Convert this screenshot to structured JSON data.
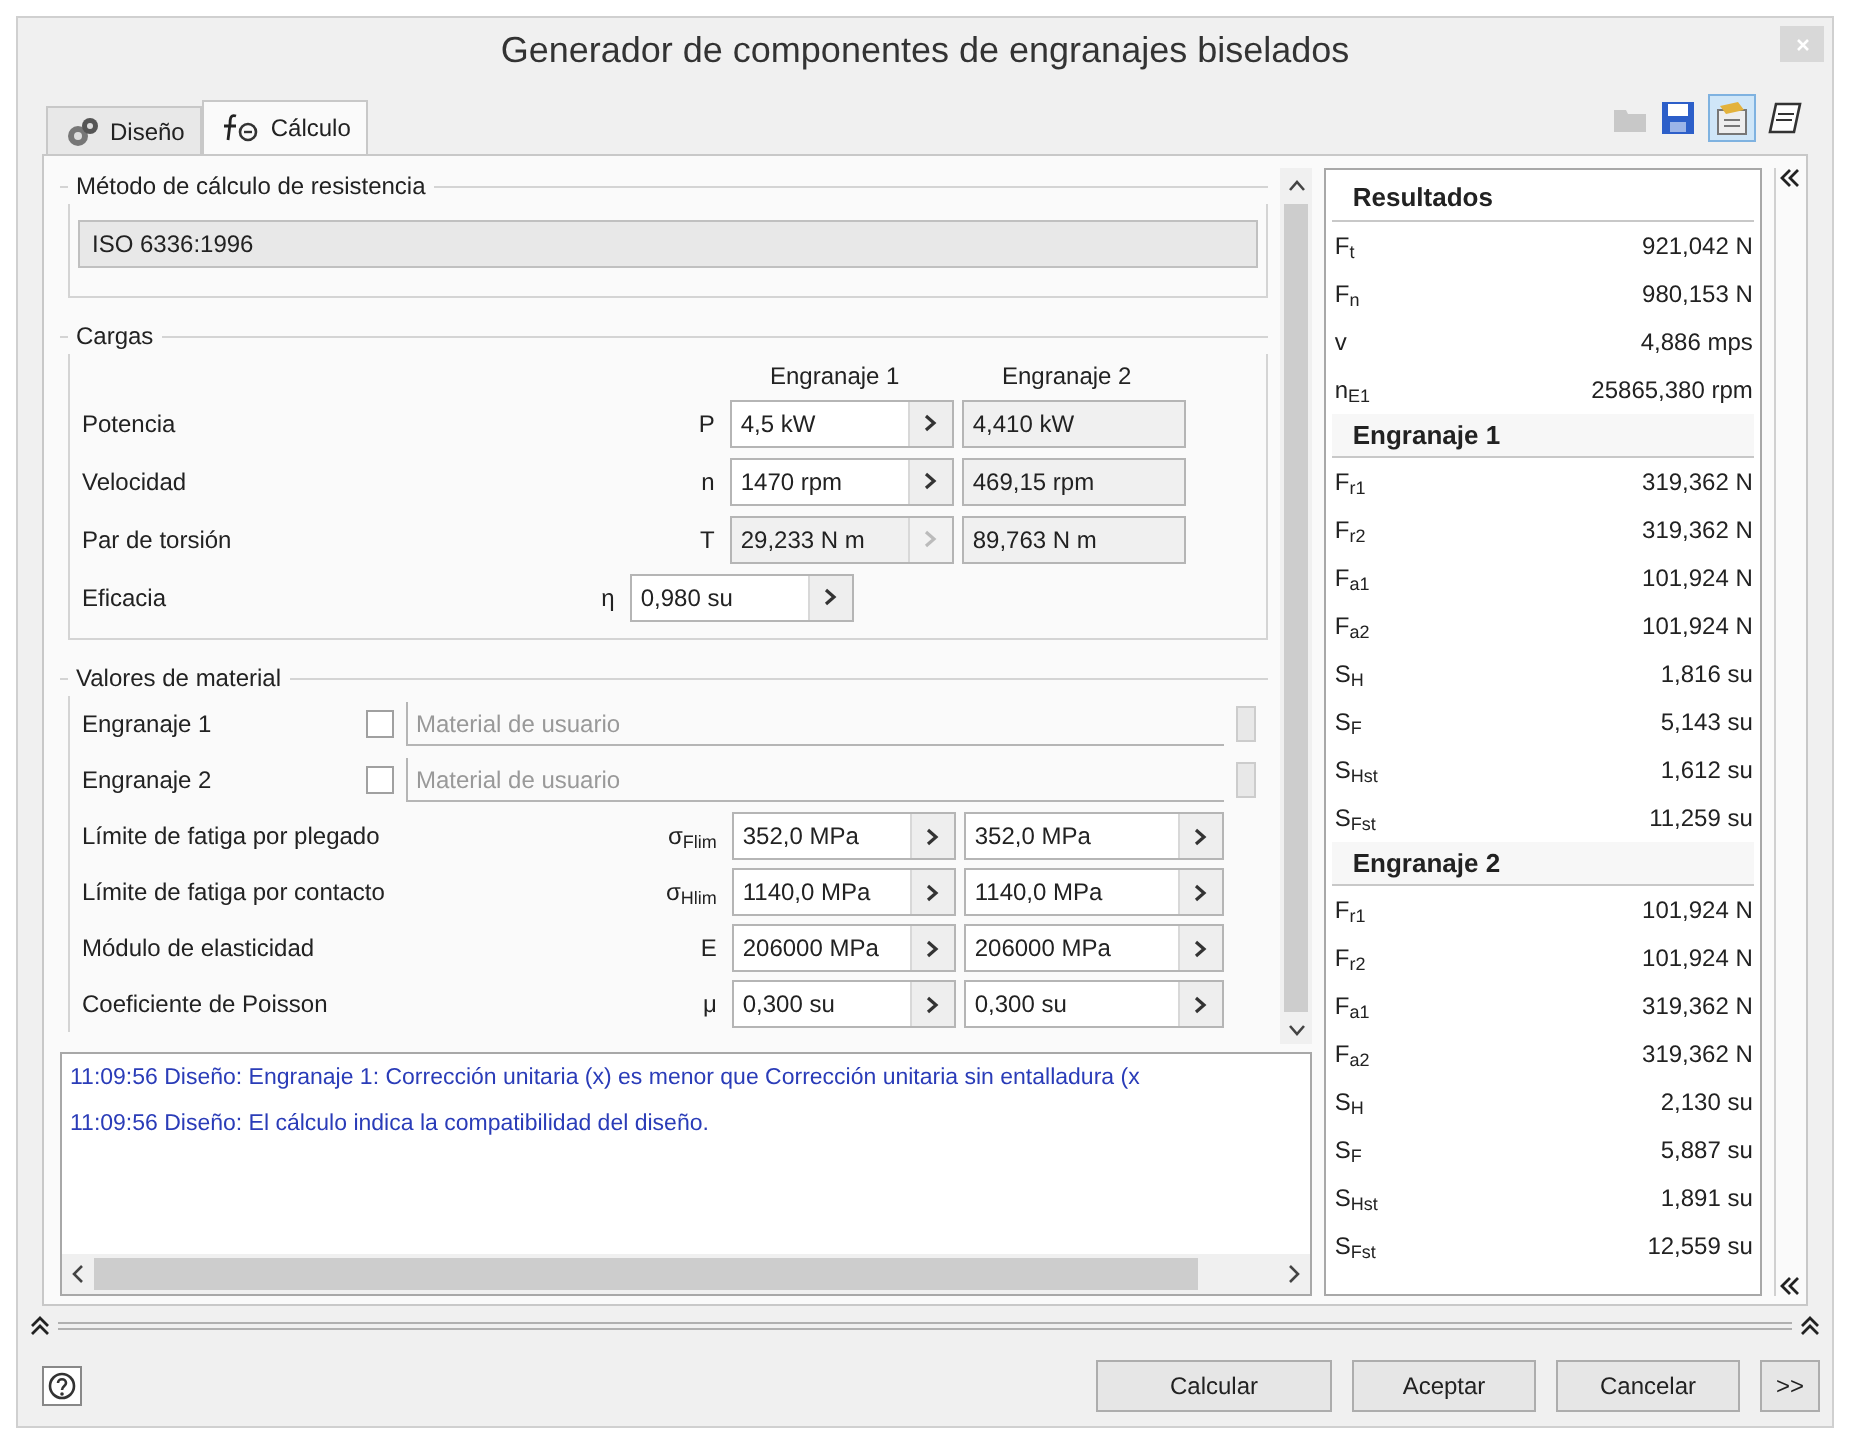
{
  "window": {
    "title": "Generador de componentes de engranajes biselados"
  },
  "tabs": [
    {
      "label": "Diseño",
      "selected": false
    },
    {
      "label": "Cálculo",
      "selected": true
    }
  ],
  "strength_method": {
    "legend": "Método de cálculo de resistencia",
    "value": "ISO 6336:1996"
  },
  "loads": {
    "legend": "Cargas",
    "columns": [
      "Engranaje 1",
      "Engranaje 2"
    ],
    "rows": [
      {
        "label": "Potencia",
        "symbol": "P",
        "gear1": {
          "value": "4,5 kW",
          "disabled": false,
          "arrow": true
        },
        "gear2": {
          "value": "4,410 kW",
          "disabled": true,
          "arrow": false
        }
      },
      {
        "label": "Velocidad",
        "symbol": "n",
        "gear1": {
          "value": "1470 rpm",
          "disabled": false,
          "arrow": true
        },
        "gear2": {
          "value": "469,15 rpm",
          "disabled": true,
          "arrow": false
        }
      },
      {
        "label": "Par de torsión",
        "symbol": "T",
        "gear1": {
          "value": "29,233 N m",
          "disabled": true,
          "arrow": true
        },
        "gear2": {
          "value": "89,763 N m",
          "disabled": true,
          "arrow": false
        }
      }
    ],
    "efficiency": {
      "label": "Eficacia",
      "symbol": "η",
      "value": "0,980 su",
      "disabled": false,
      "arrow": true
    }
  },
  "material": {
    "legend": "Valores de material",
    "gears": [
      {
        "label": "Engranaje 1",
        "checked": false,
        "placeholder": "Material de usuario"
      },
      {
        "label": "Engranaje 2",
        "checked": false,
        "placeholder": "Material de usuario"
      }
    ],
    "rows": [
      {
        "label": "Límite de fatiga por plegado",
        "symbol": "σ$_{Flim}$",
        "gear1": {
          "value": "352,0 MPa",
          "disabled": false,
          "arrow": true
        },
        "gear2": {
          "value": "352,0 MPa",
          "disabled": false,
          "arrow": true
        }
      },
      {
        "label": "Límite de fatiga por contacto",
        "symbol": "σ$_{Hlim}$",
        "gear1": {
          "value": "1140,0 MPa",
          "disabled": false,
          "arrow": true
        },
        "gear2": {
          "value": "1140,0 MPa",
          "disabled": false,
          "arrow": true
        }
      },
      {
        "label": "Módulo de elasticidad",
        "symbol": "E",
        "gear1": {
          "value": "206000 MPa",
          "disabled": false,
          "arrow": true
        },
        "gear2": {
          "value": "206000 MPa",
          "disabled": false,
          "arrow": true
        }
      },
      {
        "label": "Coeficiente de Poisson",
        "symbol": "μ",
        "gear1": {
          "value": "0,300 su",
          "disabled": false,
          "arrow": true
        },
        "gear2": {
          "value": "0,300 su",
          "disabled": false,
          "arrow": true
        }
      }
    ]
  },
  "log": [
    "11:09:56 Diseño: Engranaje 1: Corrección unitaria (x) es menor que Corrección unitaria sin entalladura (x",
    "11:09:56 Diseño: El cálculo indica la compatibilidad del diseño."
  ],
  "results": {
    "title": "Resultados",
    "sections": [
      {
        "rows": [
          {
            "symbol": "F$_{t}$",
            "value": "921,042 N"
          },
          {
            "symbol": "F$_{n}$",
            "value": "980,153 N"
          },
          {
            "symbol": "v",
            "value": "4,886 mps"
          },
          {
            "symbol": "n$_{E1}$",
            "value": "25865,380 rpm"
          }
        ]
      },
      {
        "heading": "Engranaje 1",
        "rows": [
          {
            "symbol": "F$_{r1}$",
            "value": "319,362 N"
          },
          {
            "symbol": "F$_{r2}$",
            "value": "319,362 N"
          },
          {
            "symbol": "F$_{a1}$",
            "value": "101,924 N"
          },
          {
            "symbol": "F$_{a2}$",
            "value": "101,924 N"
          },
          {
            "symbol": "S$_{H}$",
            "value": "1,816 su"
          },
          {
            "symbol": "S$_{F}$",
            "value": "5,143 su"
          },
          {
            "symbol": "S$_{Hst}$",
            "value": "1,612 su"
          },
          {
            "symbol": "S$_{Fst}$",
            "value": "11,259 su"
          }
        ]
      },
      {
        "heading": "Engranaje 2",
        "rows": [
          {
            "symbol": "F$_{r1}$",
            "value": "101,924 N"
          },
          {
            "symbol": "F$_{r2}$",
            "value": "101,924 N"
          },
          {
            "symbol": "F$_{a1}$",
            "value": "319,362 N"
          },
          {
            "symbol": "F$_{a2}$",
            "value": "319,362 N"
          },
          {
            "symbol": "S$_{H}$",
            "value": "2,130 su"
          },
          {
            "symbol": "S$_{F}$",
            "value": "5,887 su"
          },
          {
            "symbol": "S$_{Hst}$",
            "value": "1,891 su"
          },
          {
            "symbol": "S$_{Fst}$",
            "value": "12,559 su"
          }
        ]
      }
    ]
  },
  "buttons": [
    "Calcular",
    "Aceptar",
    "Cancelar"
  ],
  "more_button": ">>"
}
